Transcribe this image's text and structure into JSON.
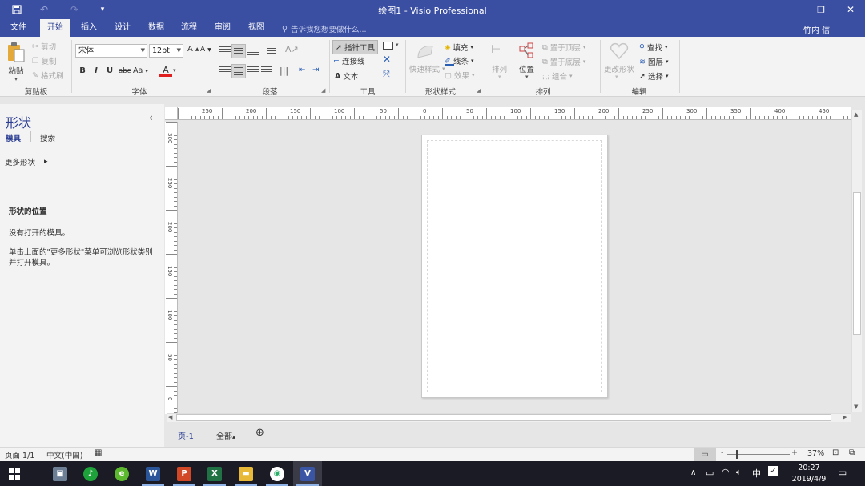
{
  "window": {
    "title": "绘图1 - Visio Professional",
    "minimize": "–",
    "restore": "❐",
    "close": "✕",
    "qat_dropdown": "▾"
  },
  "tabs": [
    {
      "label": "文件"
    },
    {
      "label": "开始",
      "active": true
    },
    {
      "label": "插入"
    },
    {
      "label": "设计"
    },
    {
      "label": "数据"
    },
    {
      "label": "流程"
    },
    {
      "label": "审阅"
    },
    {
      "label": "视图"
    }
  ],
  "tellme": "告诉我您想要做什么...",
  "user": "竹内 信",
  "ribbon": {
    "clipboard": {
      "paste": "粘贴",
      "cut": "剪切",
      "copy": "复制",
      "format_painter": "格式刷",
      "label": "剪贴板"
    },
    "font": {
      "family": "宋体",
      "size": "12pt",
      "bold": "B",
      "italic": "I",
      "underline": "U",
      "strike": "abc",
      "case": "Aa",
      "color": "A",
      "label": "字体"
    },
    "paragraph": {
      "label": "段落"
    },
    "tools": {
      "pointer": "指针工具",
      "connector": "连接线",
      "text": "文本",
      "label": "工具"
    },
    "shape_styles": {
      "quick": "快速样式",
      "fill": "填充",
      "line": "线条",
      "effects": "效果",
      "label": "形状样式"
    },
    "arrange": {
      "align": "排列",
      "position": "位置",
      "bring_front": "置于顶层",
      "send_back": "置于底层",
      "group": "组合",
      "label": "排列"
    },
    "editing": {
      "change_shape": "更改形状",
      "find": "查找",
      "layers": "图层",
      "select": "选择",
      "label": "编辑"
    }
  },
  "shapes_panel": {
    "title": "形状",
    "collapse": "‹",
    "tab_stencils": "模具",
    "tab_search": "搜索",
    "more_shapes": "更多形状",
    "more_arrow": "▸",
    "location_heading": "形状的位置",
    "no_stencils": "没有打开的模具。",
    "hint": "单击上面的\"更多形状\"菜单可浏览形状类别并打开模具。"
  },
  "ruler": {
    "h_labels": [
      "250",
      "200",
      "150",
      "100",
      "50",
      "0",
      "50",
      "100",
      "150",
      "200",
      "250",
      "300",
      "350",
      "400",
      "450"
    ],
    "v_labels": [
      "300",
      "250",
      "200",
      "150",
      "100",
      "50",
      "0"
    ]
  },
  "page_tabs": {
    "page1": "页-1",
    "all": "全部",
    "all_arrow": "▴",
    "add": "⊕"
  },
  "status": {
    "page": "页面 1/1",
    "language": "中文(中国)",
    "zoom": "37%",
    "zoom_minus": "-",
    "zoom_plus": "+"
  },
  "taskbar": {
    "time": "20:27",
    "date": "2019/4/9",
    "ime": "中",
    "word": "W",
    "ppt": "P",
    "excel": "X",
    "visio": "V"
  },
  "colors": {
    "title_bar": "#3b4fa2",
    "ribbon_bg": "#f3f3f3",
    "canvas_bg": "#e6e6e6",
    "accent": "#2b3e93",
    "taskbar": "#1b1b25"
  }
}
